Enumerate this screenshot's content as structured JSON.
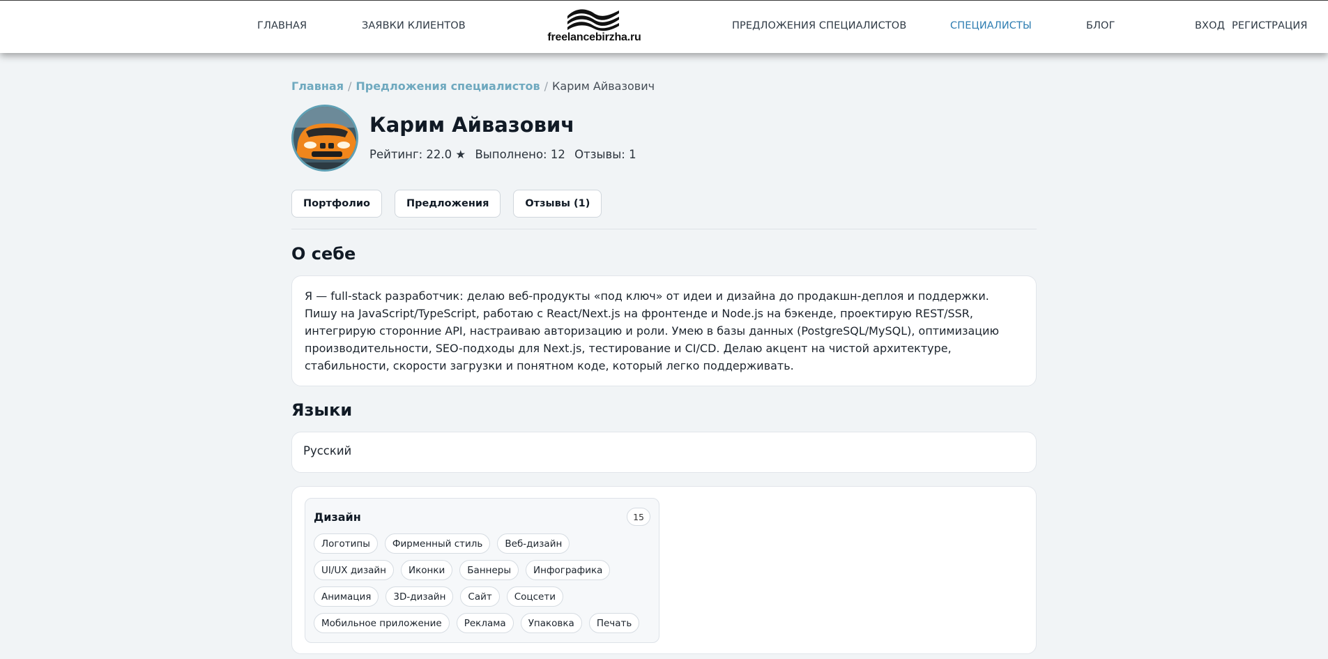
{
  "header": {
    "nav_left": [
      {
        "label": "ГЛАВНАЯ"
      },
      {
        "label": "ЗАЯВКИ КЛИЕНТОВ"
      }
    ],
    "logo_text": "freelancebirzha.ru",
    "nav_right": [
      {
        "label": "ПРЕДЛОЖЕНИЯ СПЕЦИАЛИСТОВ"
      },
      {
        "label": "СПЕЦИАЛИСТЫ",
        "active": true
      },
      {
        "label": "БЛОГ"
      }
    ],
    "login_label": "ВХОД",
    "register_label": "РЕГИСТРАЦИЯ",
    "active_color": "#2e7db1"
  },
  "breadcrumb": {
    "home": "Главная",
    "offers": "Предложения специалистов",
    "current": "Карим Айвазович",
    "separator": "/"
  },
  "profile": {
    "name": "Карим Айвазович",
    "rating": "Рейтинг: 22.0 ★",
    "completed": "Выполнено: 12",
    "reviews": "Отзывы: 1",
    "avatar_icon": "orange-car-avatar"
  },
  "tabs": [
    {
      "label": "Портфолио"
    },
    {
      "label": "Предложения"
    },
    {
      "label": "Отзывы (1)"
    }
  ],
  "about": {
    "title": "О себе",
    "text": "Я — full-stack разработчик: делаю веб-продукты «под ключ» от идеи и дизайна до продакшн-деплоя и поддержки. Пишу на JavaScript/TypeScript, работаю с React/Next.js на фронтенде и Node.js на бэкенде, проектирую REST/SSR, интегрирую сторонние API, настраиваю авторизацию и роли. Умею в базы данных (PostgreSQL/MySQL), оптимизацию производительности, SEO-подходы для Next.js, тестирование и CI/CD. Делаю акцент на чистой архитектуре, стабильности, скорости загрузки и понятном коде, который легко поддерживать."
  },
  "languages": {
    "title": "Языки",
    "value": "Русский"
  },
  "skills": {
    "category": "Дизайн",
    "count": "15",
    "items": [
      "Логотипы",
      "Фирменный стиль",
      "Веб-дизайн",
      "UI/UX дизайн",
      "Иконки",
      "Баннеры",
      "Инфографика",
      "Анимация",
      "3D-дизайн",
      "Сайт",
      "Соцсети",
      "Мобильное приложение",
      "Реклама",
      "Упаковка",
      "Печать"
    ]
  }
}
